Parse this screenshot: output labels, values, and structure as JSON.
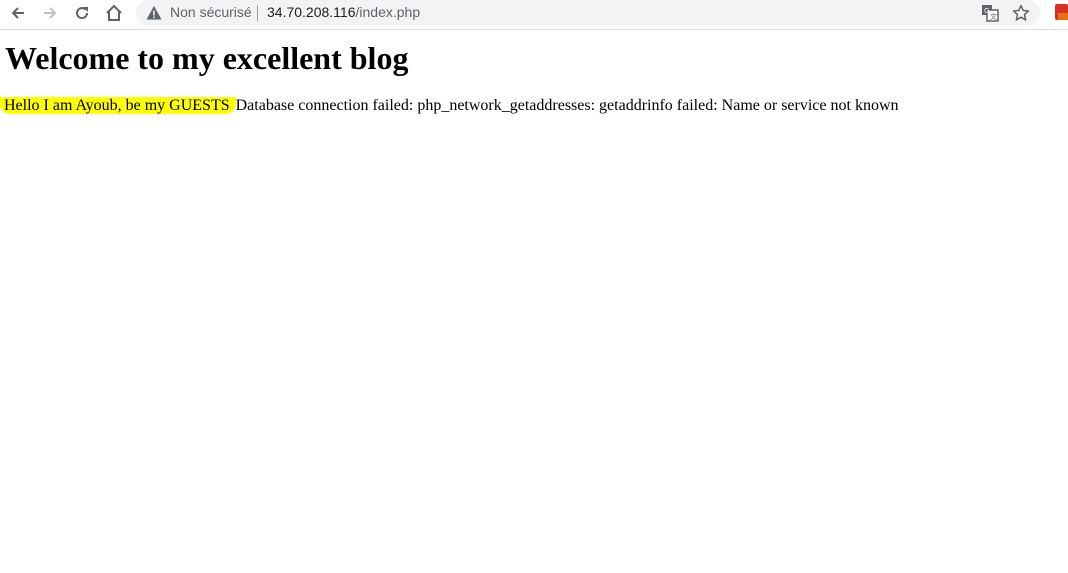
{
  "browser": {
    "security_label": "Non sécurisé",
    "url_host": "34.70.208.116",
    "url_path": "/index.php",
    "icons": {
      "back": "back-arrow-icon",
      "forward": "forward-arrow-icon",
      "reload": "reload-icon",
      "home": "home-icon",
      "warning": "warning-triangle-icon",
      "translate": "translate-icon",
      "bookmark": "star-icon",
      "extension": "extension-icon"
    }
  },
  "page": {
    "heading": "Welcome to my excellent blog",
    "greeting": "Hello I am Ayoub, be my GUESTS",
    "error_message": "Database connection failed: php_network_getaddresses: getaddrinfo failed: Name or service not known",
    "highlight_color": "#ffff00"
  }
}
